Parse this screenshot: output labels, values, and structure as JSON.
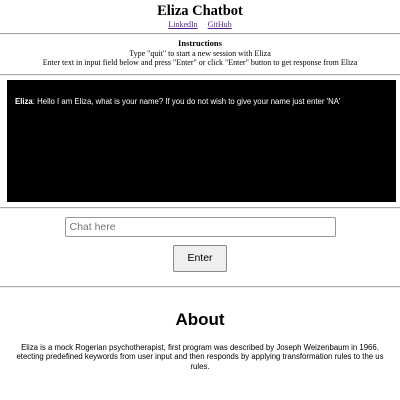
{
  "header": {
    "title": "Eliza Chatbot",
    "links": [
      {
        "label": "LinkedIn"
      },
      {
        "label": "GitHub"
      }
    ]
  },
  "instructions": {
    "heading": "Instructions",
    "line1": "Type \"quit\" to start a new session with Eliza",
    "line2": "Enter text in input field below and press \"Enter\" or click \"Enter\" button to get response from Eliza"
  },
  "chat": {
    "speaker": "Eliza",
    "separator": ":",
    "message": " Hello I am Eliza, what is your name? If you do not wish to give your name just enter 'NA'"
  },
  "input": {
    "placeholder": "Chat here",
    "value": ""
  },
  "enter_button": {
    "label": "Enter"
  },
  "about": {
    "title": "About",
    "line1": "Eliza is a mock Rogerian psychotherapist, first program was described by Joseph Weizenbaum in 1966.",
    "line2": "etecting predefined keywords from user input and then responds by applying transformation rules to the us",
    "line3": "rules."
  }
}
